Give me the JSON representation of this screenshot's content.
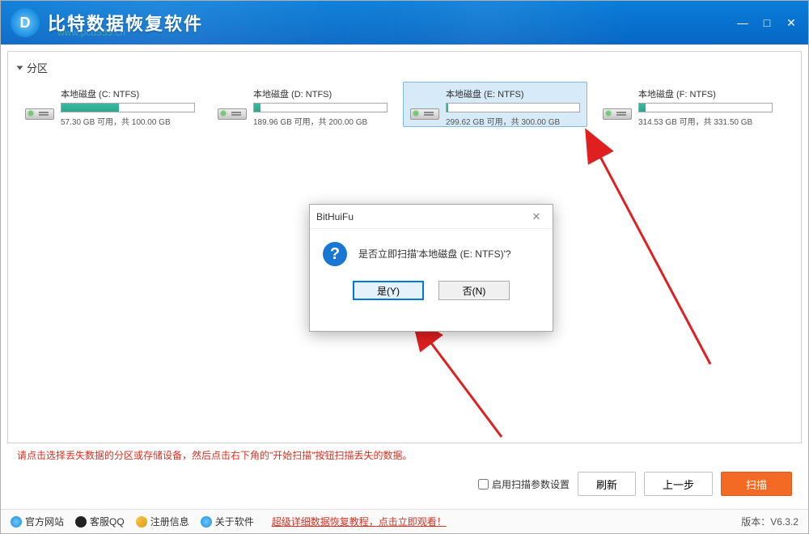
{
  "app": {
    "title": "比特数据恢复软件",
    "logo_text": "D",
    "watermark": "www.pcd559.cn"
  },
  "window_controls": {
    "min": "—",
    "max": "□",
    "close": "✕"
  },
  "section": {
    "label": "分区"
  },
  "drives": [
    {
      "name": "本地磁盘 (C: NTFS)",
      "free": "57.30 GB",
      "total": "100.00 GB",
      "fill_pct": 43,
      "selected": false
    },
    {
      "name": "本地磁盘 (D: NTFS)",
      "free": "189.96 GB",
      "total": "200.00 GB",
      "fill_pct": 5,
      "selected": false
    },
    {
      "name": "本地磁盘 (E: NTFS)",
      "free": "299.62 GB",
      "total": "300.00 GB",
      "fill_pct": 1,
      "selected": true
    },
    {
      "name": "本地磁盘 (F: NTFS)",
      "free": "314.53 GB",
      "total": "331.50 GB",
      "fill_pct": 5,
      "selected": false
    }
  ],
  "drive_stats_template": {
    "available_word": "可用，共"
  },
  "hint": "请点击选择丢失数据的分区或存储设备，然后点击右下角的\"开始扫描\"按钮扫描丢失的数据。",
  "bottom": {
    "enable_params": "启用扫描参数设置",
    "refresh": "刷新",
    "prev": "上一步",
    "scan": "扫描"
  },
  "footer": {
    "official": "官方网站",
    "qq": "客服QQ",
    "register": "注册信息",
    "about": "关于软件",
    "tutorial": "超级详细数据恢复教程，点击立即观看！",
    "version": "版本：V6.3.2"
  },
  "dialog": {
    "title": "BitHuiFu",
    "message": "是否立即扫描'本地磁盘 (E: NTFS)'?",
    "yes": "是(Y)",
    "no": "否(N)"
  }
}
